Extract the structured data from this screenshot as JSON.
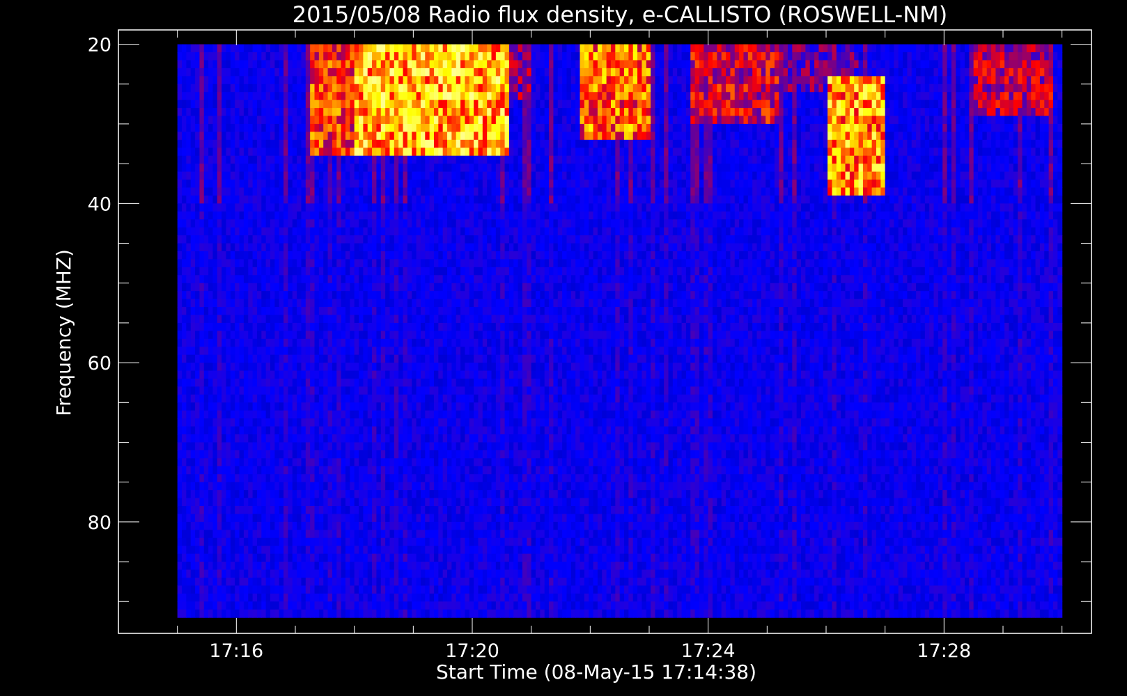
{
  "chart_data": {
    "type": "heatmap",
    "title": "2015/05/08  Radio flux density, e-CALLISTO (ROSWELL-NM)",
    "xlabel": "Start Time (08-May-15 17:14:38)",
    "ylabel": "Frequency (MHZ)",
    "x_unit": "minutes of day (UT)",
    "xlim": [
      1034.0,
      1050.5
    ],
    "ylim_reversed": [
      18.2,
      94.0
    ],
    "data_x_range": [
      1035.0,
      1050.0
    ],
    "data_y_range": [
      20.0,
      92.0
    ],
    "x_ticks": [
      {
        "value": 1036,
        "label": "17:16"
      },
      {
        "value": 1040,
        "label": "17:20"
      },
      {
        "value": 1044,
        "label": "17:24"
      },
      {
        "value": 1048,
        "label": "17:28"
      }
    ],
    "x_minor_step": 1,
    "y_ticks": [
      {
        "value": 20,
        "label": "20"
      },
      {
        "value": 40,
        "label": "40"
      },
      {
        "value": 60,
        "label": "60"
      },
      {
        "value": 80,
        "label": "80"
      }
    ],
    "y_minor_step": 5,
    "colormap": [
      "#000000",
      "#0000ff",
      "#ff0000",
      "#ffff00",
      "#ffffff"
    ],
    "background_level": 0.25,
    "burst_regions": [
      {
        "t_start": 1037.2,
        "t_end": 1038.0,
        "f_top": 20,
        "f_bottom": 33,
        "level": 0.7
      },
      {
        "t_start": 1038.0,
        "t_end": 1040.6,
        "f_top": 20,
        "f_bottom": 33,
        "level": 0.9
      },
      {
        "t_start": 1040.6,
        "t_end": 1041.0,
        "f_top": 20,
        "f_bottom": 26,
        "level": 0.5
      },
      {
        "t_start": 1041.8,
        "t_end": 1043.0,
        "f_top": 20,
        "f_bottom": 31,
        "level": 0.75
      },
      {
        "t_start": 1043.7,
        "t_end": 1045.2,
        "f_top": 20,
        "f_bottom": 29,
        "level": 0.6
      },
      {
        "t_start": 1045.2,
        "t_end": 1046.5,
        "f_top": 20,
        "f_bottom": 25,
        "level": 0.45
      },
      {
        "t_start": 1046.0,
        "t_end": 1047.0,
        "f_top": 24,
        "f_bottom": 38,
        "level": 0.85
      },
      {
        "t_start": 1048.5,
        "t_end": 1049.8,
        "f_top": 20,
        "f_bottom": 28,
        "level": 0.55
      }
    ]
  }
}
